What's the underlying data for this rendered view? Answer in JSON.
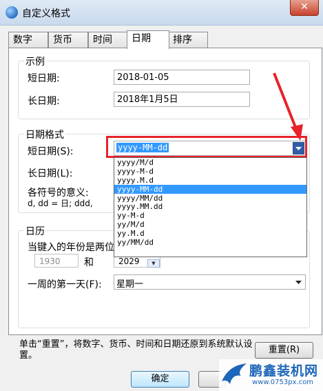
{
  "window": {
    "title": "自定义格式",
    "close_label": "✕"
  },
  "tabs": [
    {
      "label": "数字"
    },
    {
      "label": "货币"
    },
    {
      "label": "时间"
    },
    {
      "label": "日期"
    },
    {
      "label": "排序"
    }
  ],
  "examples": {
    "group_title": "示例",
    "short_label": "短日期:",
    "short_value": "2018-01-05",
    "long_label": "长日期:",
    "long_value": "2018年1月5日"
  },
  "date_formats": {
    "group_title": "日期格式",
    "short_label": "短日期(S):",
    "short_value": "yyyy-MM-dd",
    "long_label": "长日期(L):",
    "symbols_label": "各符号的意义:",
    "symbols_text": "d, dd = 日;  ddd,",
    "options": [
      "yyyy/M/d",
      "yyyy-M-d",
      "yyyy.M.d",
      "yyyy-MM-dd",
      "yyyy/MM/dd",
      "yyyy.MM.dd",
      "yy-M-d",
      "yy/M/d",
      "yy.M.d",
      "yy/MM/dd"
    ],
    "highlighted_index": 3
  },
  "calendar": {
    "group_title": "日历",
    "two_digit_label": "当键入的年份是两位",
    "year_from": "1930",
    "and_label": "和",
    "year_to": "2029",
    "first_day_label": "一周的第一天(F):",
    "first_day_value": "星期一"
  },
  "footer": {
    "reset_note": "单击“重置”，将数字、货币、时间和日期还原到系统默认设置。",
    "reset_button": "重置(R)",
    "ok_button": "确定"
  },
  "watermark": {
    "brand": "鹏鑫装机网",
    "url": "www.0753px.com"
  },
  "colors": {
    "highlight": "#3399ff",
    "annotation": "#e8232a"
  }
}
